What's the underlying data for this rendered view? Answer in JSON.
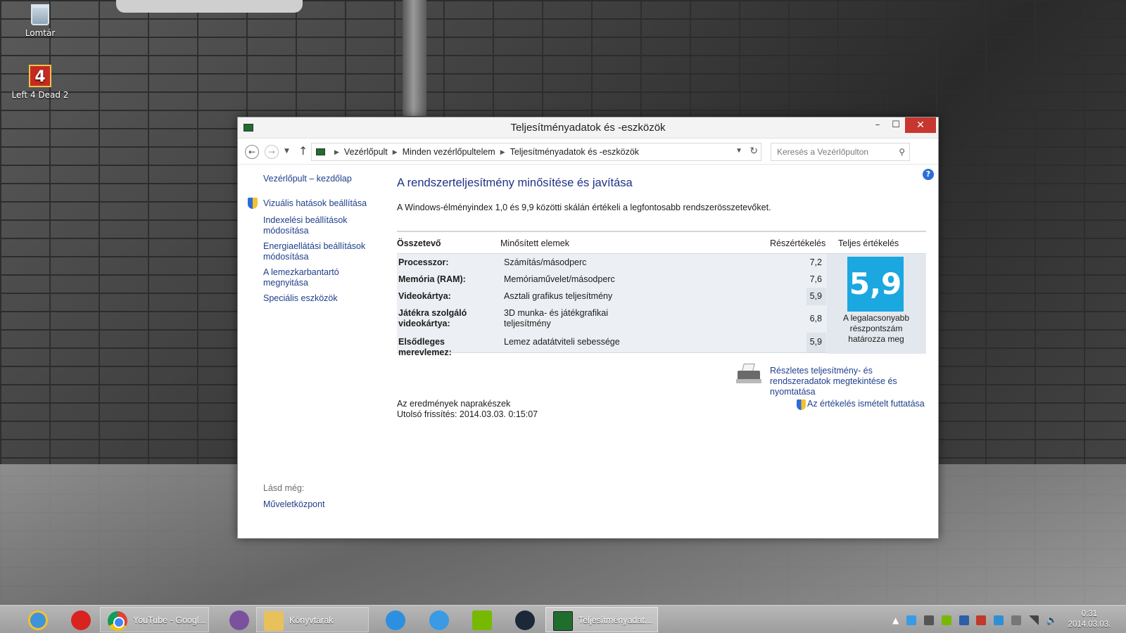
{
  "desktop": {
    "icons": [
      {
        "label": "Lomtár"
      },
      {
        "label": "Left 4 Dead 2"
      }
    ]
  },
  "window": {
    "title": "Teljesítményadatok és -eszközök",
    "controls": {
      "minimize": "–",
      "maximize": "☐",
      "close": "✕"
    }
  },
  "address": {
    "crumbs": [
      "Vezérlőpult",
      "Minden vezérlőpultelem",
      "Teljesítményadatok és -eszközök"
    ],
    "search_placeholder": "Keresés a Vezérlőpulton"
  },
  "sidebar": {
    "home": "Vezérlőpult – kezdőlap",
    "links": [
      "Vizuális hatások beállítása",
      "Indexelési beállítások módosítása",
      "Energiaellátási beállítások módosítása",
      "A lemezkarbantartó megnyitása",
      "Speciális eszközök"
    ],
    "see_also_label": "Lásd még:",
    "see_also_link": "Műveletközpont"
  },
  "main": {
    "heading": "A rendszerteljesítmény minősítése és javítása",
    "description": "A Windows-élményindex 1,0 és 9,9 közötti skálán értékeli a legfontosabb rendszerösszetevőket.",
    "columns": {
      "component": "Összetevő",
      "rated_items": "Minősített elemek",
      "subscore": "Részértékelés",
      "base_score": "Teljes értékelés"
    },
    "rows": [
      {
        "component": "Processzor:",
        "item": "Számítás/másodperc",
        "subscore": "7,2"
      },
      {
        "component": "Memória (RAM):",
        "item": "Memóriaművelet/másodperc",
        "subscore": "7,6"
      },
      {
        "component": "Videokártya:",
        "item": "Asztali grafikus teljesítmény",
        "subscore": "5,9"
      },
      {
        "component": "Játékra szolgáló videokártya:",
        "item": "3D munka- és játékgrafikai teljesítmény",
        "subscore": "6,8"
      },
      {
        "component": "Elsődleges merevlemez:",
        "item": "Lemez adatátviteli sebessége",
        "subscore": "5,9"
      }
    ],
    "base_score": "5,9",
    "base_score_note": "A legalacsonyabb részpontszám határozza meg",
    "detail_link": "Részletes teljesítmény- és rendszeradatok megtekintése és nyomtatása",
    "status": "Az eredmények naprakészek",
    "last_update": "Utolsó frissítés: 2014.03.03. 0:15:07",
    "rerun_link": "Az értékelés ismételt futtatása"
  },
  "taskbar": {
    "items": [
      {
        "label": ""
      },
      {
        "label": ""
      },
      {
        "label": "YouTube - Googl..."
      },
      {
        "label": ""
      },
      {
        "label": "Könyvtárak"
      },
      {
        "label": ""
      },
      {
        "label": ""
      },
      {
        "label": ""
      },
      {
        "label": ""
      },
      {
        "label": "Teljesítményadat..."
      }
    ],
    "clock_time": "0:31",
    "clock_date": "2014.03.03."
  }
}
